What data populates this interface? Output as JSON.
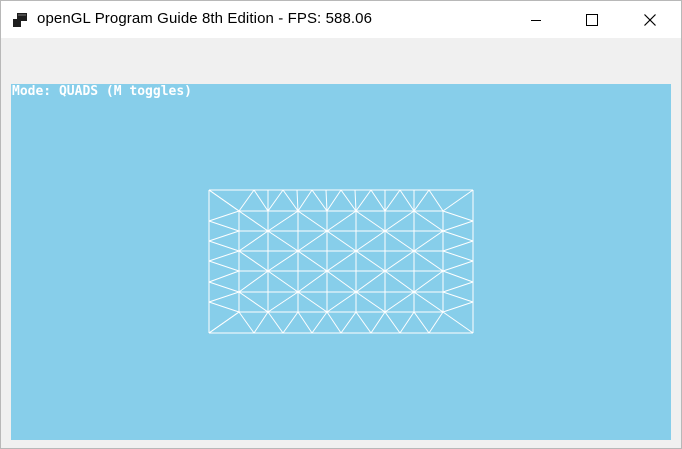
{
  "window": {
    "title": "openGL Program Guide 8th Edition - FPS: 588.06",
    "icons": {
      "app": "app-window-icon",
      "minimize": "minimize-icon",
      "maximize": "maximize-icon",
      "close": "close-icon"
    }
  },
  "viewport": {
    "background_color": "#87ceea",
    "hud_text": "Mode: QUADS (M toggles)",
    "mesh_color": "#ffffff"
  }
}
